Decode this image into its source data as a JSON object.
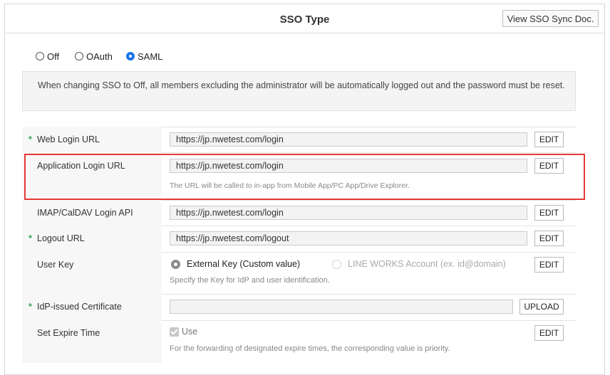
{
  "header": {
    "title": "SSO Type",
    "doc_button": "View SSO Sync Doc."
  },
  "sso_type": {
    "options": [
      "Off",
      "OAuth",
      "SAML"
    ],
    "selected": "SAML"
  },
  "notice": "When changing SSO to Off, all members excluding the administrator will be automatically logged out and the password must be reset.",
  "rows": {
    "web_login": {
      "label": "Web Login URL",
      "required": "*",
      "value": "https://jp.nwetest.com/login",
      "button": "EDIT"
    },
    "app_login": {
      "label": "Application Login URL",
      "value": "https://jp.nwetest.com/login",
      "button": "EDIT",
      "hint": "The URL will be called to in-app from Mobile App/PC App/Drive Explorer."
    },
    "imap": {
      "label": "IMAP/CalDAV Login API",
      "value": "https://jp.nwetest.com/login",
      "button": "EDIT"
    },
    "logout": {
      "label": "Logout URL",
      "required": "*",
      "value": "https://jp.nwetest.com/logout",
      "button": "EDIT"
    },
    "user_key": {
      "label": "User Key",
      "option_external": "External Key (Custom value)",
      "option_lineworks": "LINE WORKS Account (ex. id@domain)",
      "selected": "External Key (Custom value)",
      "button": "EDIT",
      "hint": "Specify the Key for IdP and user identification."
    },
    "certificate": {
      "label": "IdP-issued Certificate",
      "required": "*",
      "value": "",
      "button": "UPLOAD"
    },
    "expire": {
      "label": "Set Expire Time",
      "checkbox_label": "Use",
      "checked": true,
      "button": "EDIT",
      "hint": "For the forwarding of designated expire times, the corresponding value is priority."
    }
  },
  "colors": {
    "accent": "#1a73e8",
    "required": "#3aa35c",
    "highlight": "#e53935"
  }
}
